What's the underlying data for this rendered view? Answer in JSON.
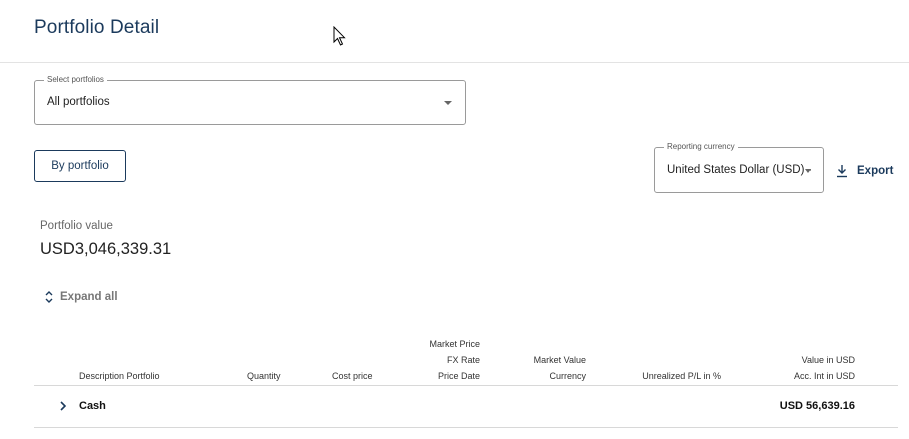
{
  "header": {
    "title": "Portfolio Detail"
  },
  "select_portfolios": {
    "label": "Select portfolios",
    "value": "All portfolios"
  },
  "by_portfolio_button": {
    "label": "By portfolio"
  },
  "reporting_currency": {
    "label": "Reporting currency",
    "value": "United States Dollar (USD) -"
  },
  "export": {
    "label": "Export"
  },
  "portfolio_value": {
    "label": "Portfolio value",
    "value": "USD3,046,339.31"
  },
  "expand_all": {
    "label": "Expand all"
  },
  "table": {
    "columns": {
      "description": "Description Portfolio",
      "quantity": "Quantity",
      "cost_price": "Cost price",
      "market_price": [
        "Market Price",
        "FX Rate",
        "Price Date"
      ],
      "market_value": [
        "Market Value",
        "Currency"
      ],
      "unrealized": "Unrealized P/L in %",
      "value_usd": [
        "Value in USD",
        "Acc. Int in USD"
      ]
    },
    "rows": [
      {
        "label": "Cash",
        "value": "USD 56,639.16"
      }
    ]
  },
  "colors": {
    "brand": "#1b3a5c",
    "border": "#9a9a9a"
  },
  "icons": [
    "mouse-cursor-icon",
    "chevron-down-icon",
    "download-icon",
    "expand-collapse-icon",
    "chevron-right-icon"
  ]
}
